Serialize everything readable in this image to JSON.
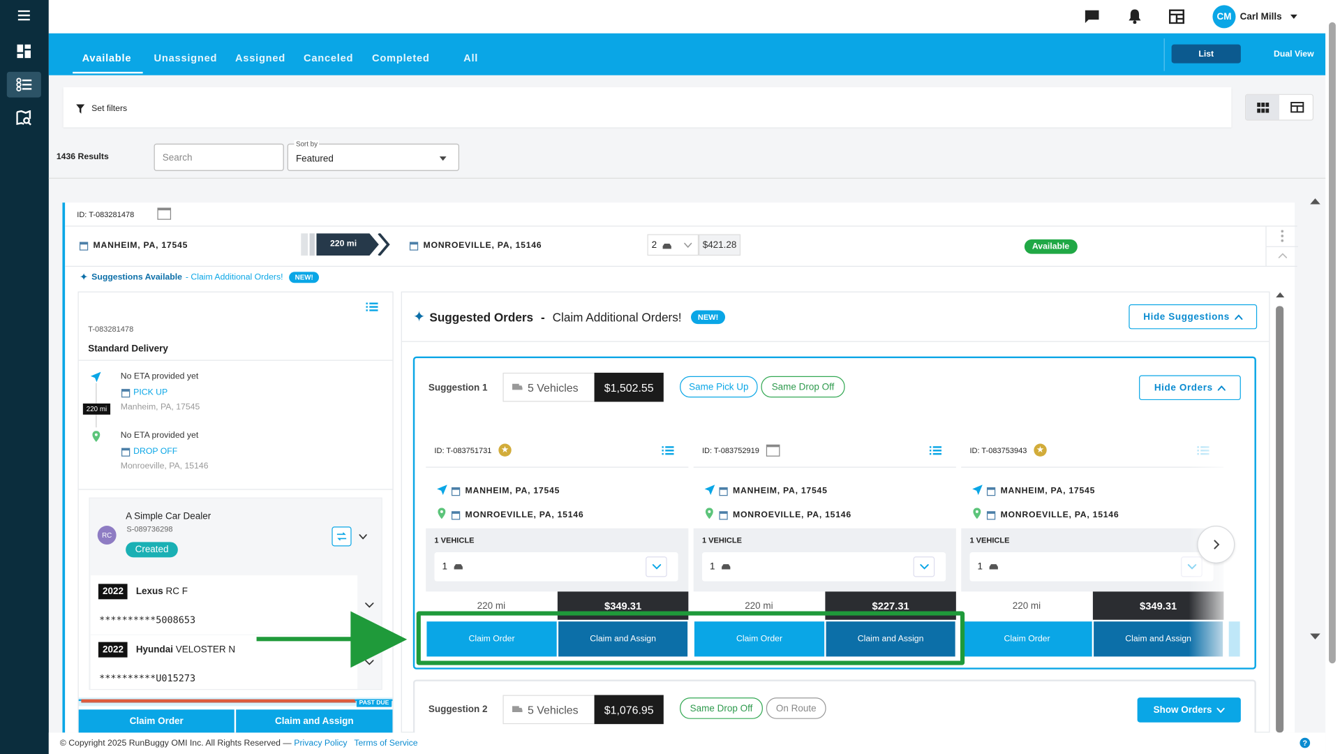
{
  "user": {
    "initials": "CM",
    "name": "Carl Mills"
  },
  "tabs": [
    "Available",
    "Unassigned",
    "Assigned",
    "Canceled",
    "Completed",
    "All"
  ],
  "view_toggle": {
    "list": "List",
    "dual": "Dual View"
  },
  "filters": {
    "label": "Set filters"
  },
  "results": {
    "count": "1436 Results",
    "search_placeholder": "Search",
    "sort_label": "Sort by",
    "sort_value": "Featured"
  },
  "main_order": {
    "id": "ID: T-083281478",
    "origin": "MANHEIM, PA, 17545",
    "distance": "220 mi",
    "destination": "MONROEVILLE, PA, 15146",
    "vehicles": "2",
    "price": "$421.28",
    "status": "Available",
    "suggestions_title": "Suggestions Available",
    "suggestions_sub": " - Claim Additional Orders!",
    "new_badge": "NEW!"
  },
  "detail": {
    "ref": "T-083281478",
    "service": "Standard Delivery",
    "pickup_eta": "No ETA provided yet",
    "pickup_label": "PICK UP",
    "pickup_addr": "Manheim, PA, 17545",
    "distance": "220 mi",
    "dropoff_eta": "No ETA provided yet",
    "dropoff_label": "DROP OFF",
    "dropoff_addr": "Monroeville, PA, 15146",
    "dealer_initials": "RC",
    "dealer_name": "A Simple Car Dealer",
    "dealer_id": "S-089736298",
    "dealer_status": "Created",
    "vehicles": [
      {
        "year": "2022",
        "make": "Lexus",
        "model": "RC F",
        "vin": "**********5008653"
      },
      {
        "year": "2022",
        "make": "Hyundai",
        "model": "VELOSTER N",
        "vin": "**********U015273"
      }
    ],
    "past_due": "PAST DUE",
    "claim_order": "Claim Order",
    "claim_assign": "Claim and Assign"
  },
  "suggested": {
    "title": "Suggested Orders",
    "title_dash": " - ",
    "subtitle": "Claim Additional Orders!",
    "new_badge": "NEW!",
    "hide_suggestions": "Hide Suggestions",
    "suggestion1": {
      "label": "Suggestion 1",
      "vehicles": "5 Vehicles",
      "price": "$1,502.55",
      "tag1": "Same Pick Up",
      "tag2": "Same Drop Off",
      "toggle": "Hide Orders"
    },
    "suggestion2": {
      "label": "Suggestion 2",
      "vehicles": "5 Vehicles",
      "price": "$1,076.95",
      "tag1": "Same Drop Off",
      "tag2": "On Route",
      "toggle": "Show Orders"
    },
    "orders": [
      {
        "id": "ID: T-083751731",
        "origin": "MANHEIM, PA, 17545",
        "dest": "MONROEVILLE, PA, 15146",
        "vehicle_count": "1 VEHICLE",
        "qty": "1",
        "distance": "220 mi",
        "price": "$349.31",
        "claim": "Claim Order",
        "assign": "Claim and Assign"
      },
      {
        "id": "ID: T-083752919",
        "origin": "MANHEIM, PA, 17545",
        "dest": "MONROEVILLE, PA, 15146",
        "vehicle_count": "1 VEHICLE",
        "qty": "1",
        "distance": "220 mi",
        "price": "$227.31",
        "claim": "Claim Order",
        "assign": "Claim and Assign"
      },
      {
        "id": "ID: T-083753943",
        "origin": "MANHEIM, PA, 17545",
        "dest": "MONROEVILLE, PA, 15146",
        "vehicle_count": "1 VEHICLE",
        "qty": "1",
        "distance": "220 mi",
        "price": "$349.31",
        "claim": "Claim Order",
        "assign": "Claim and Assign"
      }
    ]
  },
  "footer": {
    "copyright": "© Copyright 2025 RunBuggy OMI Inc. All Rights Reserved — ",
    "privacy": "Privacy Policy",
    "terms": "Terms of Service"
  },
  "colors": {
    "primary": "#0aa6e6",
    "dark_primary": "#0c6fa8",
    "sidebar": "#0b2d3d",
    "highlight": "#1f9a3a",
    "available": "#20a845"
  }
}
